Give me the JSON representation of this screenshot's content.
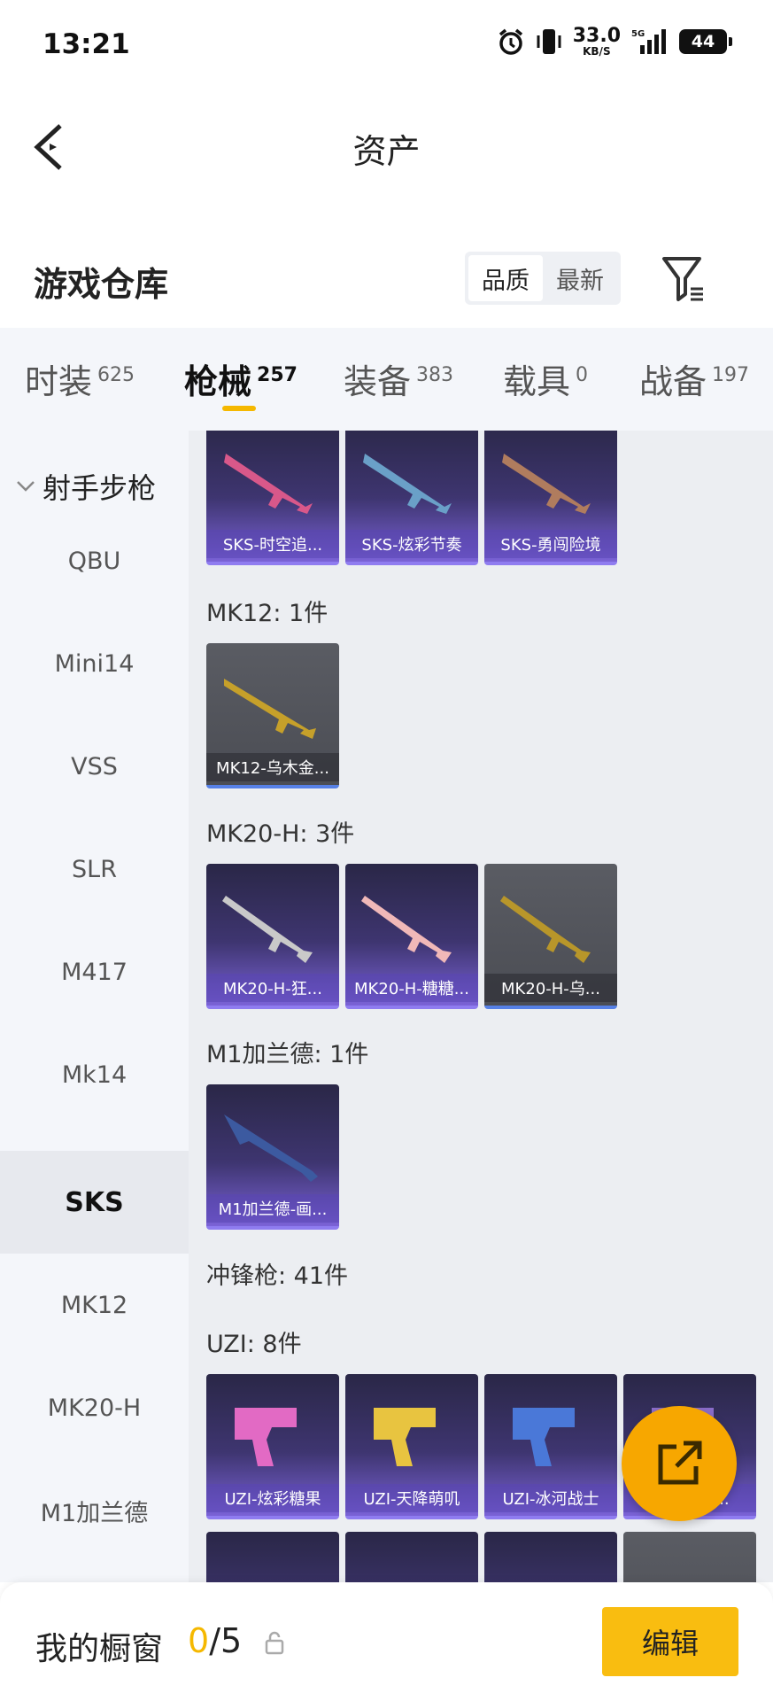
{
  "status_bar": {
    "time": "13:21",
    "net_speed": "33.0",
    "net_unit": "KB/S",
    "battery": "44"
  },
  "header": {
    "title": "资产"
  },
  "section": {
    "title": "游戏仓库",
    "sort_options": [
      "品质",
      "最新"
    ],
    "active_sort": "品质"
  },
  "tabs": [
    {
      "label": "时装",
      "count": "625"
    },
    {
      "label": "枪械",
      "count": "257"
    },
    {
      "label": "装备",
      "count": "383"
    },
    {
      "label": "载具",
      "count": "0"
    },
    {
      "label": "战备",
      "count": "197"
    }
  ],
  "active_tab": "枪械",
  "sidebar": {
    "category": "射手步枪",
    "items": [
      "QBU",
      "Mini14",
      "VSS",
      "SLR",
      "M417",
      "Mk14",
      "SKS",
      "MK12",
      "MK20-H",
      "M1加兰德"
    ],
    "active": "SKS"
  },
  "content": {
    "sks_row": [
      {
        "name": "SKS-时空追...",
        "style": "purple"
      },
      {
        "name": "SKS-炫彩节奏",
        "style": "purple"
      },
      {
        "name": "SKS-勇闯险境",
        "style": "purple"
      }
    ],
    "mk12": {
      "title": "MK12: 1件",
      "items": [
        {
          "name": "MK12-乌木金...",
          "style": "grey"
        }
      ]
    },
    "mk20h": {
      "title": "MK20-H: 3件",
      "items": [
        {
          "name": "MK20-H-狂...",
          "style": "purple"
        },
        {
          "name": "MK20-H-糖糖...",
          "style": "purple"
        },
        {
          "name": "MK20-H-乌...",
          "style": "grey"
        }
      ]
    },
    "m1": {
      "title": "M1加兰德: 1件",
      "items": [
        {
          "name": "M1加兰德-画...",
          "style": "purple"
        }
      ]
    },
    "smg_title": "冲锋枪: 41件",
    "uzi": {
      "title": "UZI: 8件",
      "items": [
        {
          "name": "UZI-炫彩糖果",
          "style": "purple"
        },
        {
          "name": "UZI-天降萌叽",
          "style": "purple"
        },
        {
          "name": "UZI-冰河战士",
          "style": "purple"
        },
        {
          "name": "UZI-...程...",
          "style": "purple"
        }
      ]
    }
  },
  "bottom_bar": {
    "label": "我的橱窗",
    "current": "0",
    "total": "/5",
    "edit_label": "编辑"
  },
  "colors": {
    "accent": "#f5b800",
    "edit_button": "#f9bd10",
    "fab": "#f7a700",
    "card_purple": "#3e3570",
    "card_grey": "#4b4d54"
  }
}
